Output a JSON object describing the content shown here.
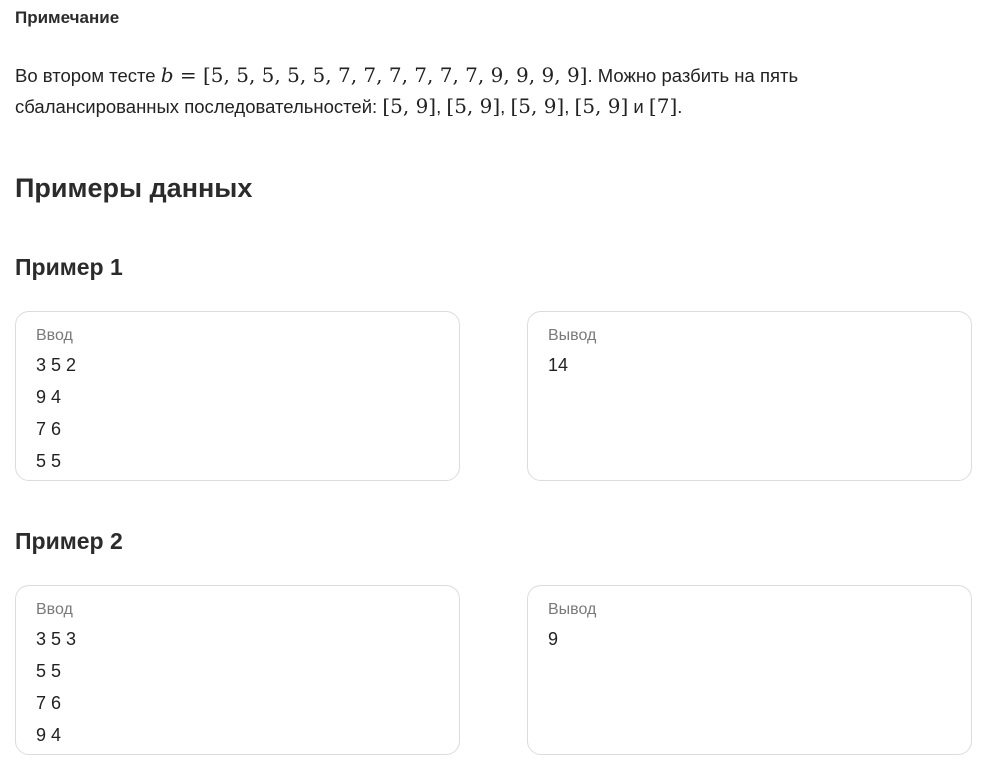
{
  "note": {
    "title": "Примечание",
    "text_1": "Во втором тесте ",
    "var_b": "b",
    "eq": " = ",
    "seq": "[5, 5, 5, 5, 5, 7, 7, 7, 7, 7, 7, 9, 9, 9, 9]",
    "text_2": ". Можно разбить на пять сбалансированных последовательностей: ",
    "p1": "[5, 9]",
    "comma": ", ",
    "p2": "[5, 9]",
    "p3": "[5, 9]",
    "p4": "[5, 9]",
    "and": " и ",
    "p5": "[7]",
    "dot": "."
  },
  "section": {
    "title": "Примеры данных"
  },
  "examples": [
    {
      "title": "Пример 1",
      "input_label": "Ввод",
      "input_lines": [
        "3 5 2",
        "9 4",
        "7 6",
        "5 5"
      ],
      "output_label": "Вывод",
      "output_lines": [
        "14"
      ]
    },
    {
      "title": "Пример 2",
      "input_label": "Ввод",
      "input_lines": [
        "3 5 3",
        "5 5",
        "7 6",
        "9 4"
      ],
      "output_label": "Вывод",
      "output_lines": [
        "9"
      ]
    }
  ]
}
